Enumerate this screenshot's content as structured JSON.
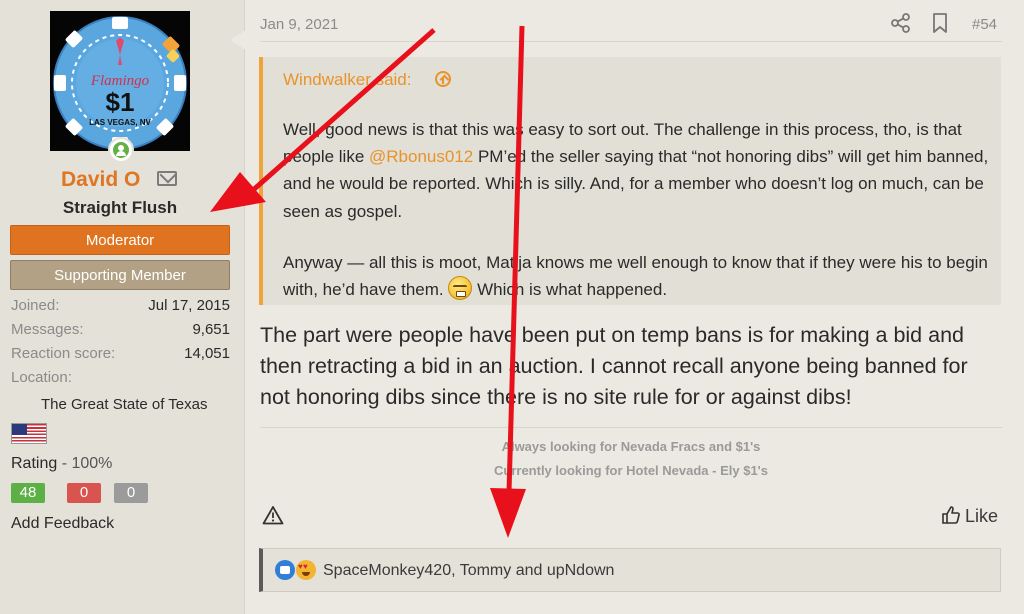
{
  "user": {
    "name": "David O",
    "title": "Straight Flush",
    "banners": [
      "Moderator",
      "Supporting Member"
    ],
    "avatar_chip": {
      "brand": "Flamingo",
      "value": "$1",
      "city": "LAS VEGAS, NV"
    },
    "stats": [
      {
        "label": "Joined:",
        "value": "Jul 17, 2015"
      },
      {
        "label": "Messages:",
        "value": "9,651"
      },
      {
        "label": "Reaction score:",
        "value": "14,051"
      },
      {
        "label": "Location:",
        "value": ""
      }
    ],
    "location": "The Great State of Texas",
    "rating_label": "Rating",
    "rating_value": "- 100%",
    "feedback": {
      "positive": "48",
      "negative": "0",
      "neutral": "0"
    },
    "add_feedback": "Add Feedback"
  },
  "post": {
    "date": "Jan 9, 2021",
    "number": "#54",
    "quote": {
      "author": "Windwalker said:",
      "p1_before": "Well, good news is that this was easy to sort out. The challenge in this process, tho, is that people like ",
      "mention": "@Rbonus012",
      "p1_after": " PM’ed the seller saying that “not honoring dibs” will get him banned, and he would be reported. Which is silly. And, for a member who doesn’t log on much, can be seen as gospel.",
      "p2_before": "Anyway — all this is moot, Matija knows me well enough to know that if they were his to begin with, he’d have them. ",
      "p2_after": " Which is what happened."
    },
    "body": "The part were people have been put on temp bans is for making a bid and then retracting a bid in an auction. I cannot recall anyone being banned for not honoring dibs since there is no site rule for or against dibs!",
    "signature": [
      "Always looking for Nevada Fracs and $1's",
      "Currently looking for Hotel Nevada - Ely $1's"
    ],
    "like_label": "Like",
    "reactions": "SpaceMonkey420, Tommy and upNdown"
  },
  "icons": [
    "share-icon",
    "bookmark-icon",
    "report-icon",
    "like-thumb-icon",
    "mail-icon",
    "online-status-icon",
    "us-flag-icon",
    "like-reaction-icon",
    "love-reaction-icon",
    "grin-smiley-icon",
    "quote-jump-icon"
  ],
  "colors": {
    "accent": "#e07522",
    "quote_border": "#f0a33a",
    "moderator": "#e0731f",
    "supporting": "#b3a185",
    "annotation_arrow": "#e8101a"
  }
}
